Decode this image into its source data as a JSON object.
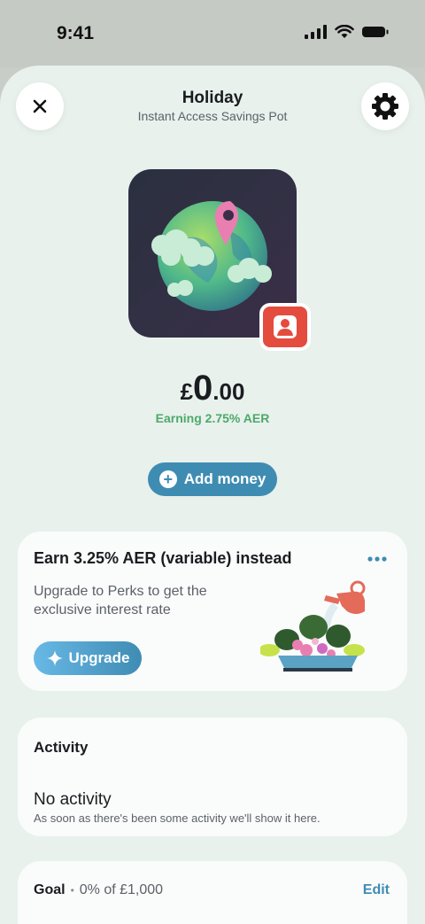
{
  "status_bar": {
    "time": "9:41"
  },
  "header": {
    "title": "Holiday",
    "subtitle": "Instant Access Savings Pot",
    "close_icon": "close-icon",
    "settings_icon": "gear-icon"
  },
  "pot": {
    "image": "globe-with-location-pin",
    "owner_badge_icon": "person-icon",
    "balance_currency": "£",
    "balance_main": "0",
    "balance_decimals": ".00",
    "earning": "Earning 2.75% AER"
  },
  "actions": {
    "add_money": "Add money"
  },
  "promo": {
    "title": "Earn 3.25% AER (variable) instead",
    "description": "Upgrade to Perks to get the exclusive interest rate",
    "button": "Upgrade"
  },
  "activity": {
    "title": "Activity",
    "empty_title": "No activity",
    "empty_hint": "As soon as there's been some activity we'll show it here."
  },
  "goal": {
    "label": "Goal",
    "progress": "0% of £1,000",
    "edit": "Edit"
  },
  "colors": {
    "accent": "#3f8cb3",
    "earning_green": "#4ea96a",
    "badge_red": "#e44c3e",
    "sheet_bg": "#e8f1ec"
  }
}
